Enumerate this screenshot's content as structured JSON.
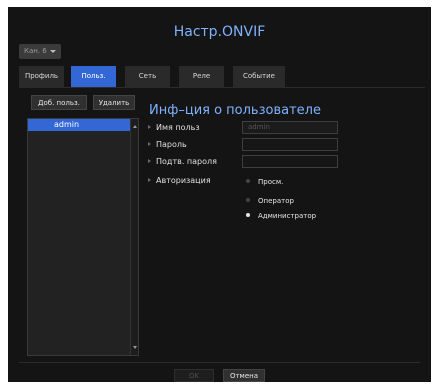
{
  "dialog": {
    "title": "Настр.ONVIF"
  },
  "channel": {
    "label": "Кан. 6"
  },
  "tabs": [
    {
      "label": "Профиль",
      "active": false
    },
    {
      "label": "Польз.",
      "active": true
    },
    {
      "label": "Сеть",
      "active": false
    },
    {
      "label": "Реле",
      "active": false
    },
    {
      "label": "Событие",
      "active": false
    }
  ],
  "user_list": {
    "add_button": "Доб. польз.",
    "delete_button": "Удалить",
    "items": [
      "admin"
    ]
  },
  "user_info": {
    "title": "Инф–ция о пользователе",
    "username_label": "Имя польз",
    "username_value": "admin",
    "password_label": "Пароль",
    "password_value": "",
    "confirm_label": "Подтв. пароля",
    "confirm_value": "",
    "auth_label": "Авторизация",
    "auth_options": [
      {
        "label": "Просм.",
        "selected": false
      },
      {
        "label": "Оператор",
        "selected": false
      },
      {
        "label": "Администратор",
        "selected": true
      }
    ]
  },
  "footer": {
    "ok_button": "OK",
    "cancel_button": "Отмена"
  },
  "colors": {
    "accent": "#3367d6",
    "title": "#7fb2ff",
    "background": "#141414"
  }
}
